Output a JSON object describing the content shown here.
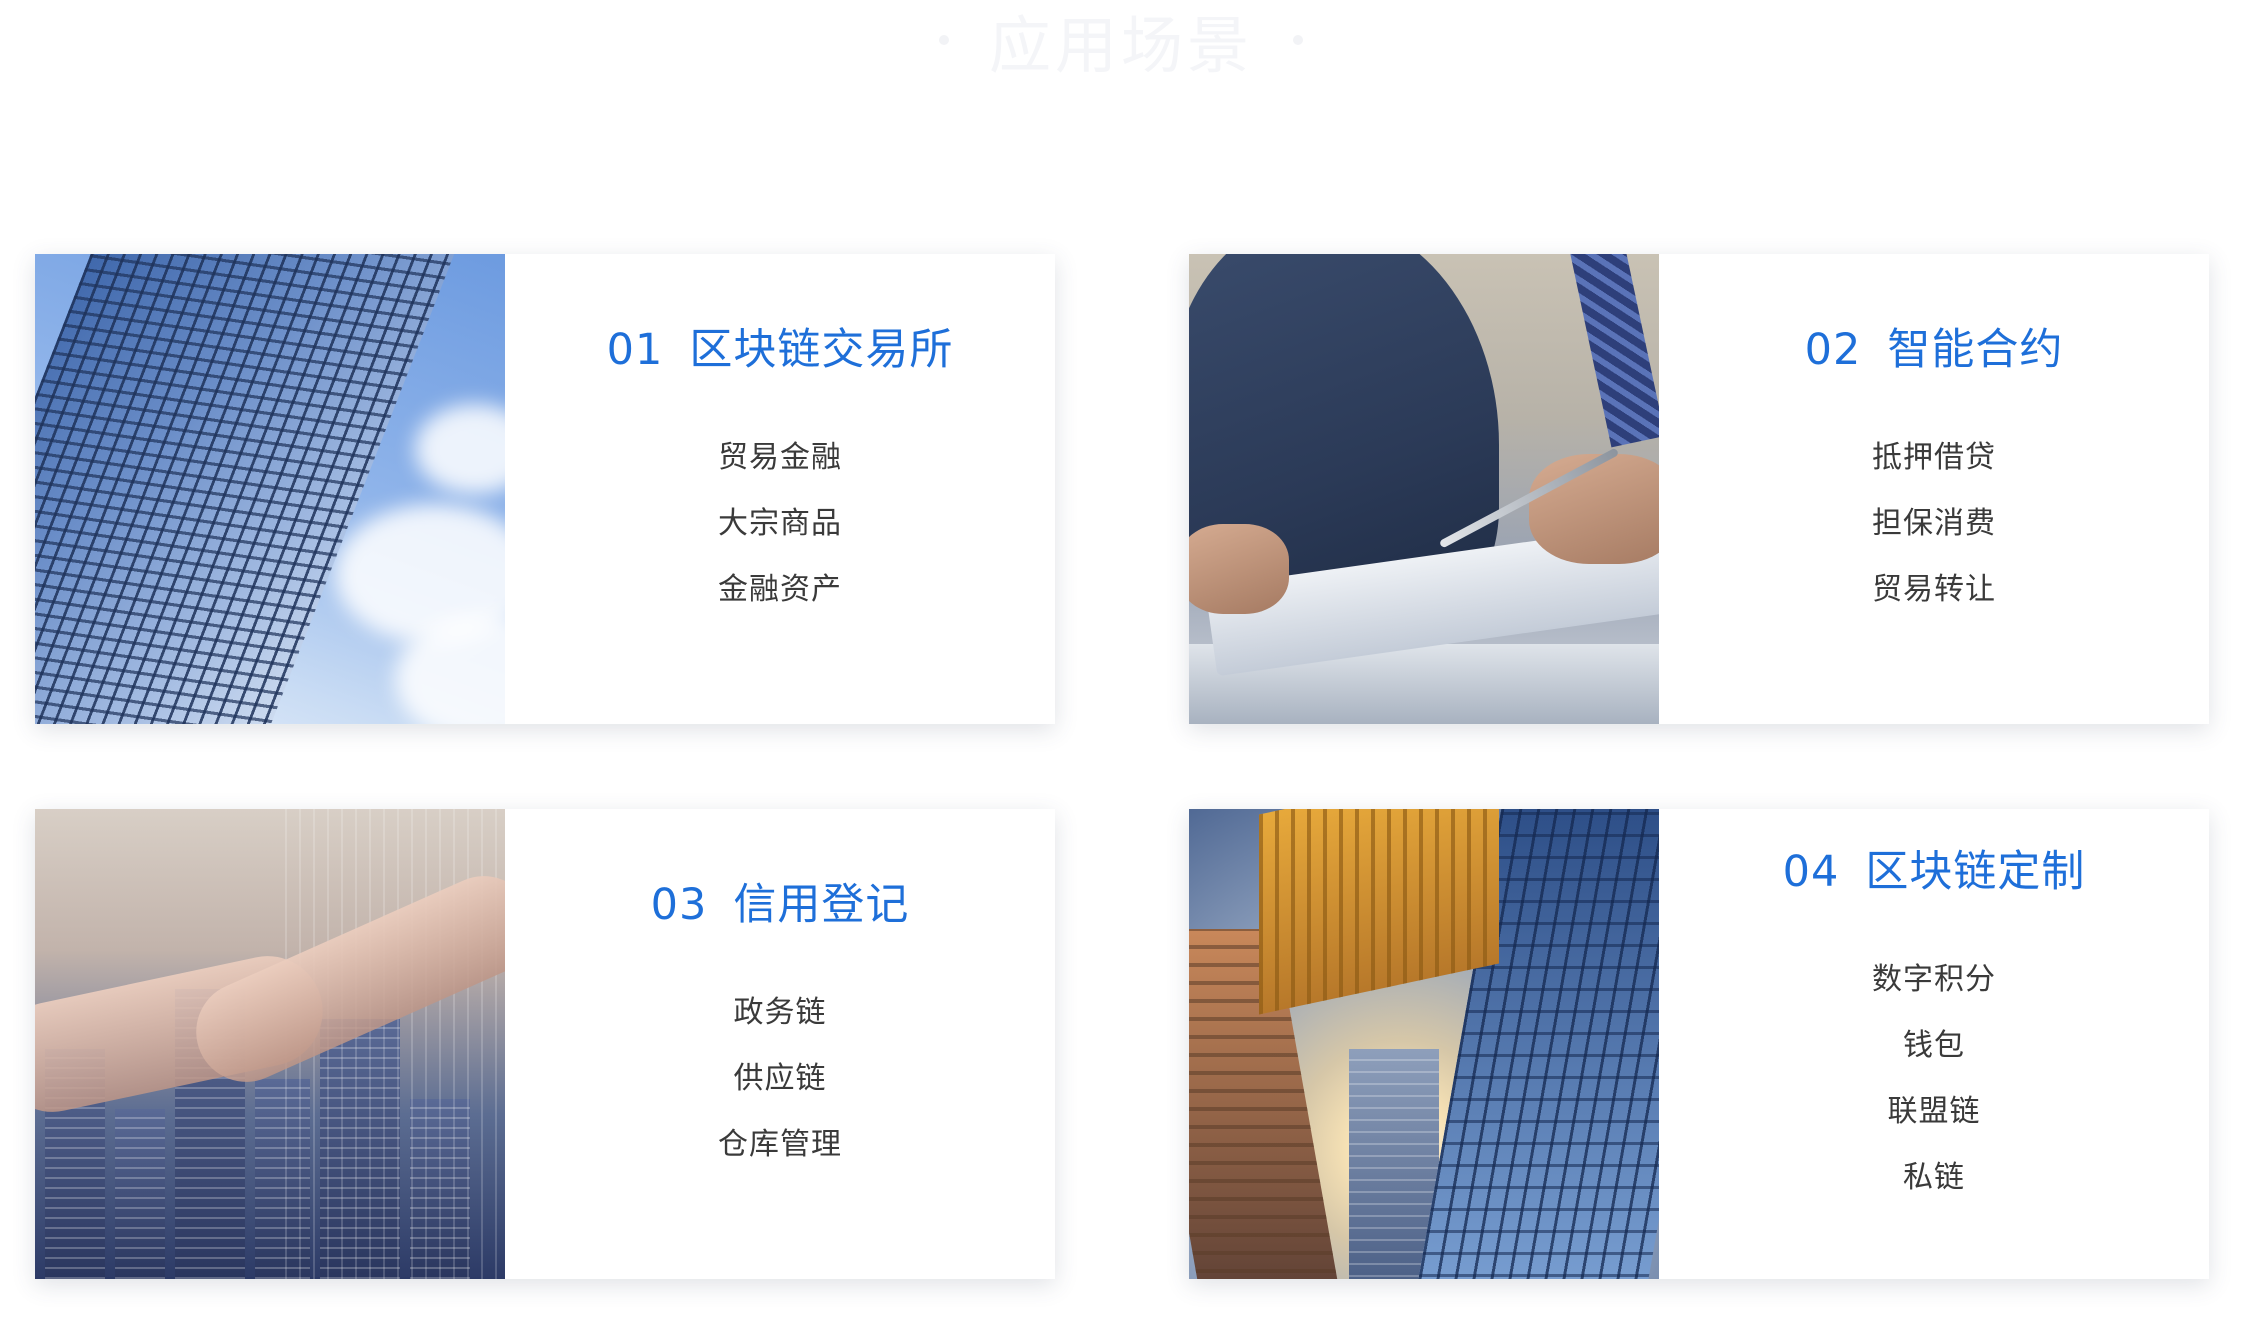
{
  "page": {
    "heading": "应用场景"
  },
  "cards": [
    {
      "number": "01",
      "title": "区块链交易所",
      "items": [
        "贸易金融",
        "大宗商品",
        "金融资产"
      ]
    },
    {
      "number": "02",
      "title": "智能合约",
      "items": [
        "抵押借贷",
        "担保消费",
        "贸易转让"
      ]
    },
    {
      "number": "03",
      "title": "信用登记",
      "items": [
        "政务链",
        "供应链",
        "仓库管理"
      ]
    },
    {
      "number": "04",
      "title": "区块链定制",
      "items": [
        "数字积分",
        "钱包",
        "联盟链",
        "私链"
      ]
    }
  ],
  "colors": {
    "accent": "#1e6fd9",
    "text": "#3a3a3a",
    "heading_faint": "#f4f5f8"
  }
}
